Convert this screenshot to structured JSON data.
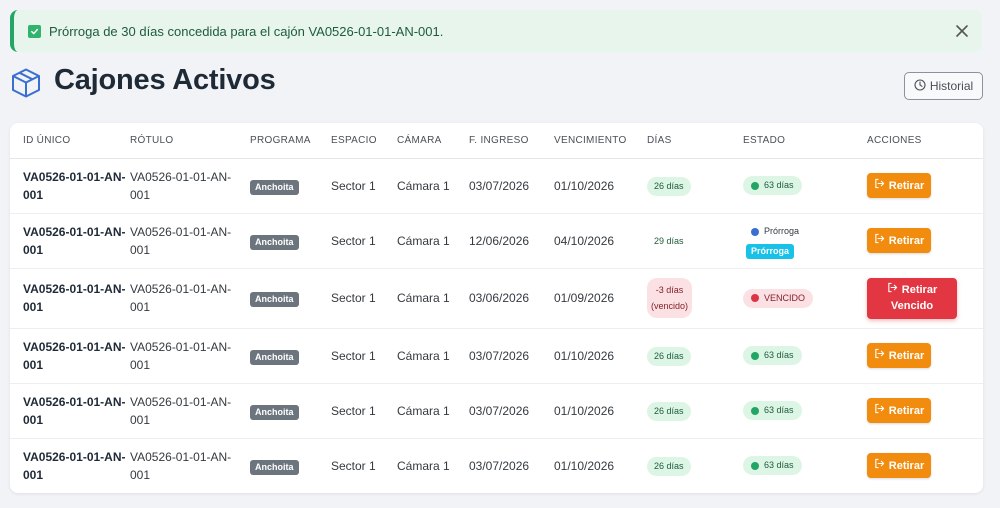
{
  "alert": {
    "message": "Prórroga de 30 días concedida para el cajón VA0526-01-01-AN-001."
  },
  "page": {
    "title": "Cajones Activos",
    "historial_label": "Historial"
  },
  "table": {
    "headers": [
      "ID ÚNICO",
      "RÓTULO",
      "PROGRAMA",
      "ESPACIO",
      "CÁMARA",
      "F. INGRESO",
      "VENCIMIENTO",
      "DÍAS",
      "ESTADO",
      "ACCIONES"
    ],
    "rows": [
      {
        "id": "VA0526-01-01-AN-001",
        "rotulo": "VA0526-01-01-AN-001",
        "programa": "Anchoita",
        "espacio": "Sector 1",
        "camara": "Cámara 1",
        "ingreso": "03/07/2026",
        "vencimiento": "01/10/2026",
        "dias": "26 días",
        "estado": "63 días",
        "accion": "Retirar"
      },
      {
        "id": "VA0526-01-01-AN-001",
        "rotulo": "VA0526-01-01-AN-001",
        "programa": "Anchoita",
        "espacio": "Sector 1",
        "camara": "Cámara 1",
        "ingreso": "12/06/2026",
        "vencimiento": "04/10/2026",
        "dias": "29 días",
        "estado": "Prórroga",
        "estado_tag": "Prórroga",
        "accion": "Retirar"
      },
      {
        "id": "VA0526-01-01-AN-001",
        "rotulo": "VA0526-01-01-AN-001",
        "programa": "Anchoita",
        "espacio": "Sector 1",
        "camara": "Cámara 1",
        "ingreso": "03/06/2026",
        "vencimiento": "01/09/2026",
        "dias": "-3 días",
        "dias_sub": "(vencido)",
        "estado": "VENCIDO",
        "accion": "Retirar",
        "accion_sub": "Vencido"
      },
      {
        "id": "VA0526-01-01-AN-001",
        "rotulo": "VA0526-01-01-AN-001",
        "programa": "Anchoita",
        "espacio": "Sector 1",
        "camara": "Cámara 1",
        "ingreso": "03/07/2026",
        "vencimiento": "01/10/2026",
        "dias": "26 días",
        "estado": "63 días",
        "accion": "Retirar"
      },
      {
        "id": "VA0526-01-01-AN-001",
        "rotulo": "VA0526-01-01-AN-001",
        "programa": "Anchoita",
        "espacio": "Sector 1",
        "camara": "Cámara 1",
        "ingreso": "03/07/2026",
        "vencimiento": "01/10/2026",
        "dias": "26 días",
        "estado": "63 días",
        "accion": "Retirar"
      },
      {
        "id": "VA0526-01-01-AN-001",
        "rotulo": "VA0526-01-01-AN-001",
        "programa": "Anchoita",
        "espacio": "Sector 1",
        "camara": "Cámara 1",
        "ingreso": "03/07/2026",
        "vencimiento": "01/10/2026",
        "dias": "26 días",
        "estado": "63 días",
        "accion": "Retirar"
      }
    ]
  },
  "colors": {
    "success": "#22a565",
    "warning_button": "#f28c0f",
    "danger_button": "#e23742",
    "info_tag": "#17c1e8",
    "program_badge": "#6c757d"
  },
  "icons": [
    "check-square-icon",
    "close-icon",
    "box-icon",
    "clock-history-icon",
    "exit-icon"
  ]
}
